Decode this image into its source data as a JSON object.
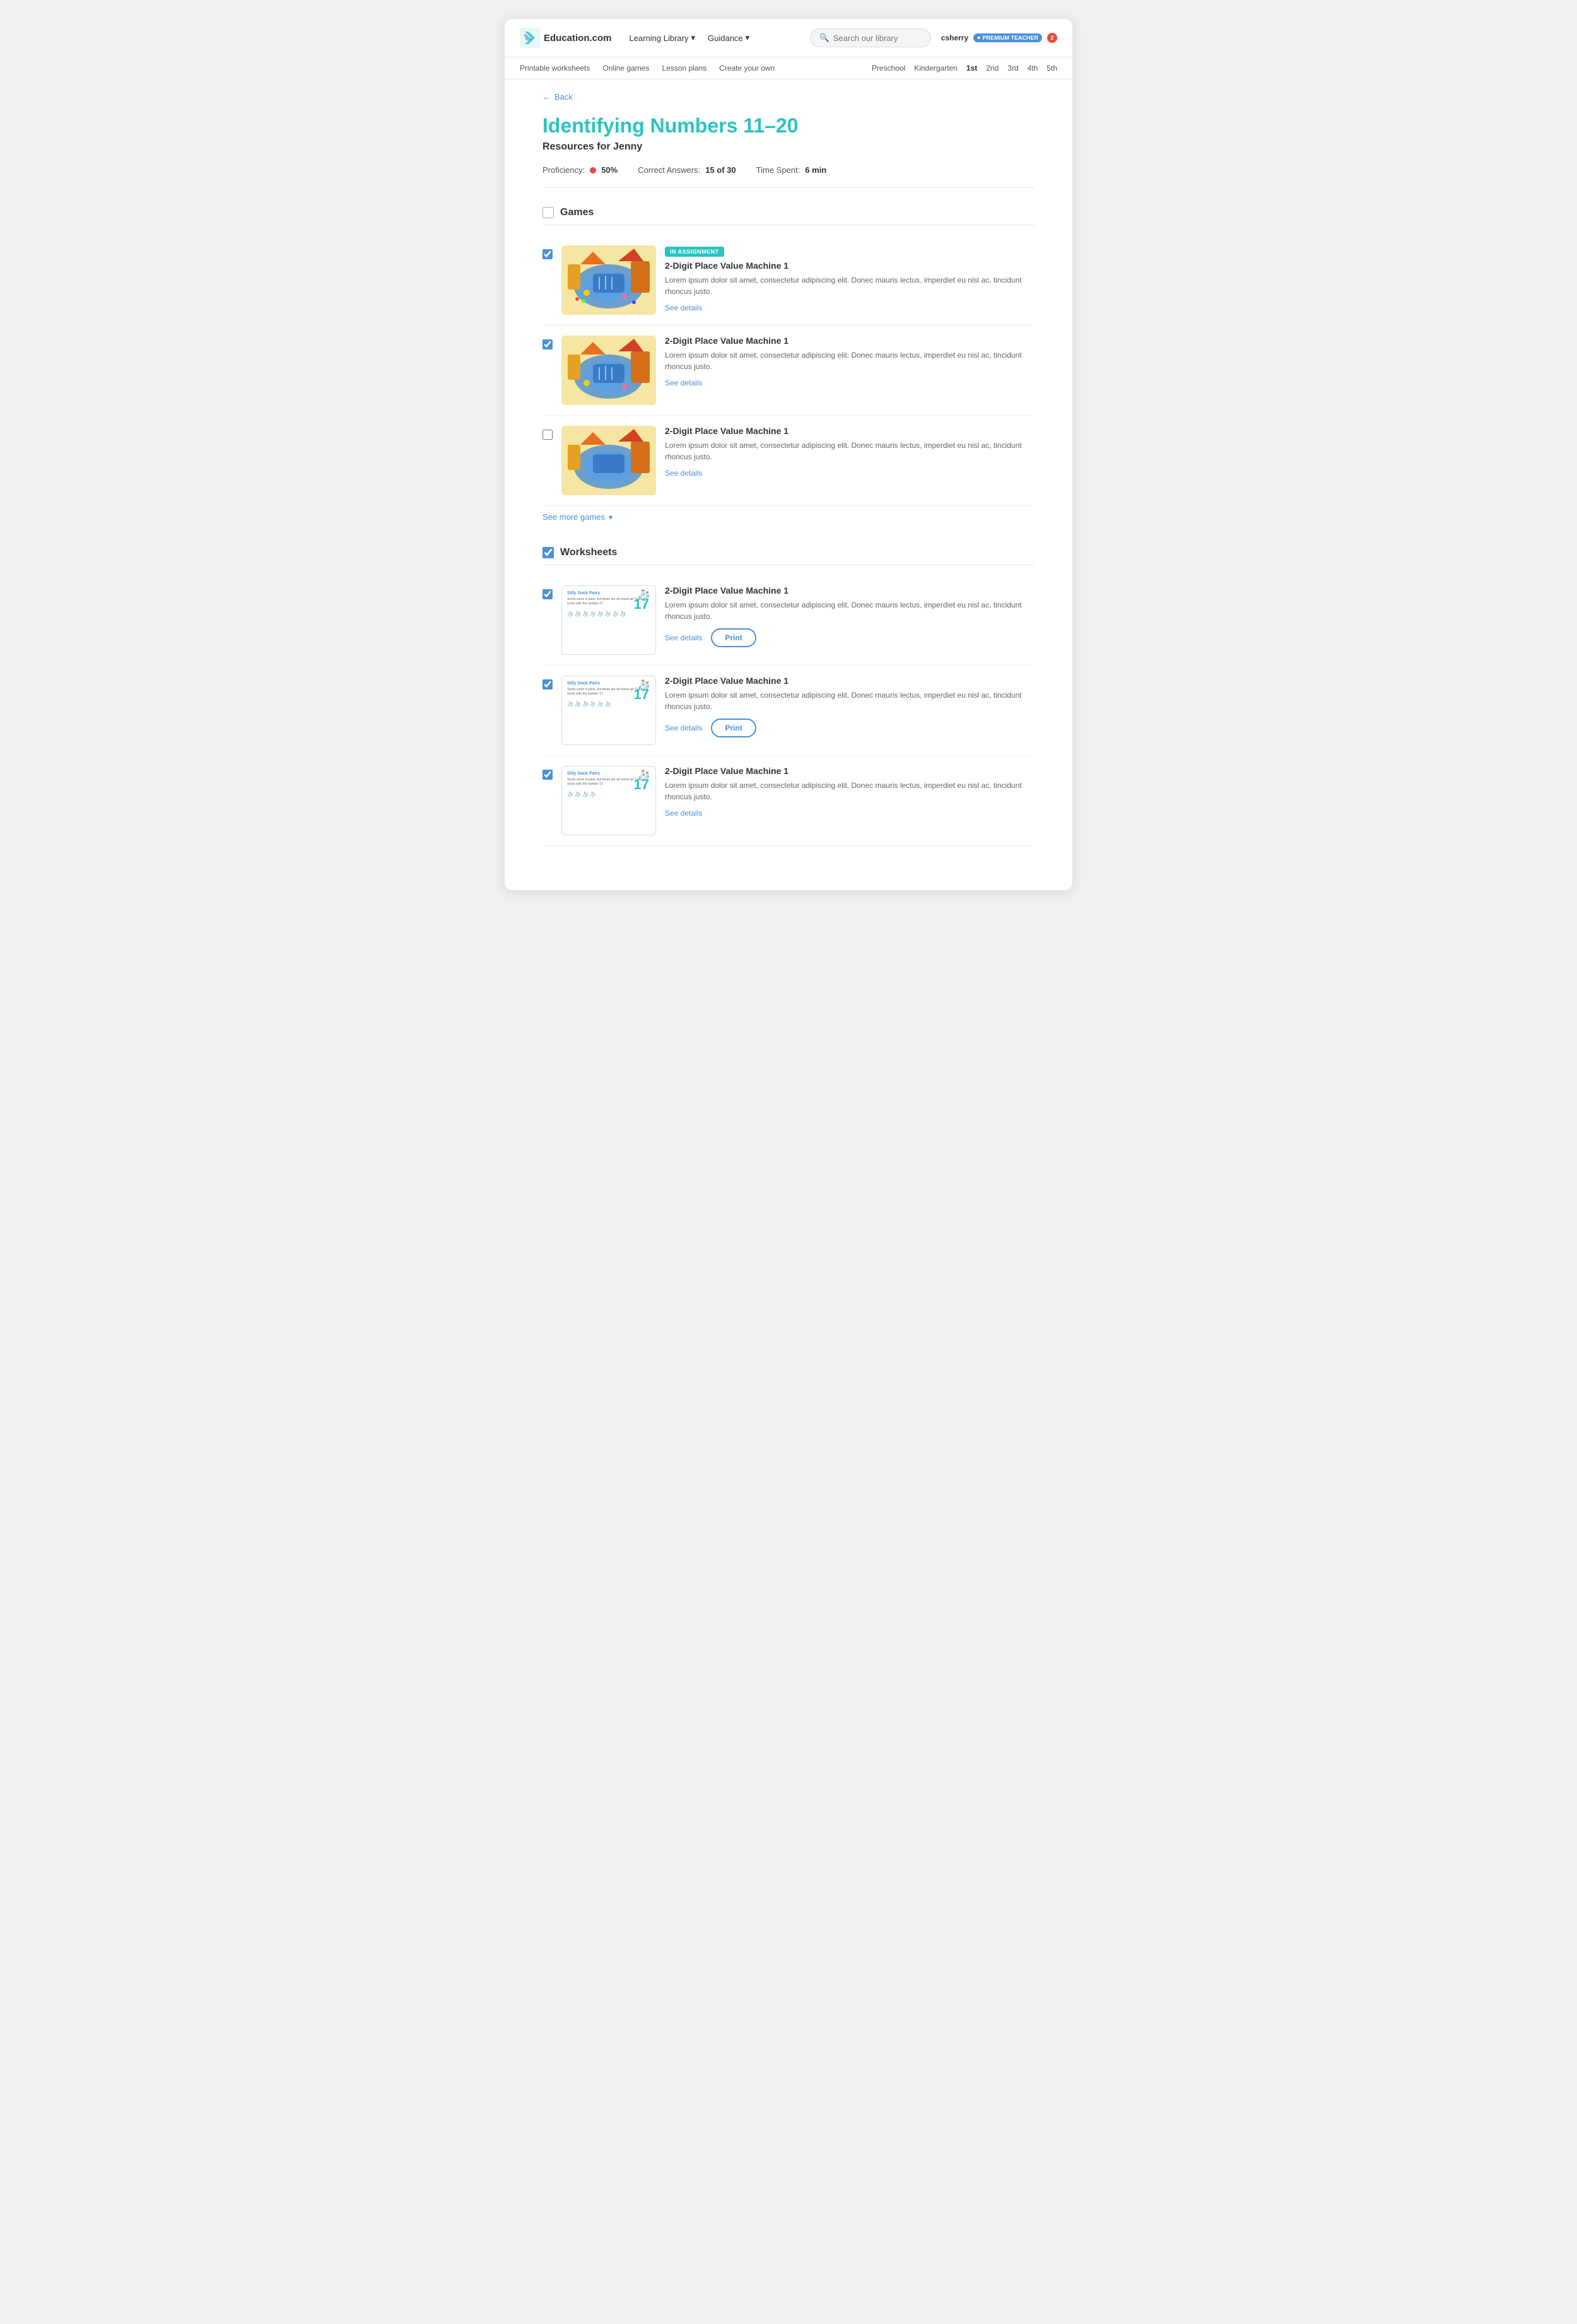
{
  "site": {
    "logo_text": "Education.com",
    "logo_icon": "🔖"
  },
  "header": {
    "nav": [
      {
        "label": "Learning Library",
        "has_arrow": true
      },
      {
        "label": "Guidance",
        "has_arrow": true
      }
    ],
    "search_placeholder": "Search our library",
    "user": {
      "username": "csherry",
      "badge_label": "PREMIUM TEACHER",
      "notification_count": "2"
    }
  },
  "sub_nav": {
    "left": [
      {
        "label": "Printable worksheets"
      },
      {
        "label": "Online games"
      },
      {
        "label": "Lesson plans"
      },
      {
        "label": "Create your own"
      }
    ],
    "right": [
      {
        "label": "Preschool"
      },
      {
        "label": "Kindergarten"
      },
      {
        "label": "1st"
      },
      {
        "label": "2nd"
      },
      {
        "label": "3rd"
      },
      {
        "label": "4th"
      },
      {
        "label": "5th"
      }
    ]
  },
  "back_label": "Back",
  "page_title": "Identifying Numbers 11–20",
  "resources_subtitle": "Resources for Jenny",
  "stats": {
    "proficiency_label": "Proficiency:",
    "proficiency_value": "50%",
    "correct_label": "Correct Answers:",
    "correct_value": "15 of 30",
    "time_label": "Time Spent:",
    "time_value": "6 min"
  },
  "sections": [
    {
      "id": "games",
      "title": "Games",
      "checked": false,
      "indeterminate": true,
      "items": [
        {
          "id": "game1",
          "checked": true,
          "in_assignment": true,
          "badge": "IN ASSIGNMENT",
          "title": "2-Digit Place Value Machine 1",
          "desc": "Lorem ipsum dolor sit amet, consectetur adipiscing elit. Donec mauris lectus, imperdiet eu nisl ac, tincidunt rhoncus justo.",
          "actions": [
            "see_details"
          ]
        },
        {
          "id": "game2",
          "checked": true,
          "in_assignment": false,
          "badge": "",
          "title": "2-Digit Place Value Machine 1",
          "desc": "Lorem ipsum dolor sit amet, consectetur adipiscing elit. Donec mauris lectus, imperdiet eu nisl ac, tincidunt rhoncus justo.",
          "actions": [
            "see_details"
          ]
        },
        {
          "id": "game3",
          "checked": false,
          "in_assignment": false,
          "badge": "",
          "title": "2-Digit Place Value Machine 1",
          "desc": "Lorem ipsum dolor sit amet, consectetur adipiscing elit. Donec mauris lectus, imperdiet eu nisl ac, tincidunt rhoncus justo.",
          "actions": [
            "see_details"
          ]
        }
      ],
      "see_more_label": "See more games"
    },
    {
      "id": "worksheets",
      "title": "Worksheets",
      "checked": true,
      "indeterminate": false,
      "items": [
        {
          "id": "ws1",
          "checked": true,
          "in_assignment": false,
          "badge": "",
          "title": "2-Digit Place Value Machine 1",
          "desc": "Lorem ipsum dolor sit amet, consectetur adipiscing elit. Donec mauris lectus, imperdiet eu nisl ac, tincidunt rhoncus justo.",
          "actions": [
            "see_details",
            "print"
          ],
          "worksheet_title": "Silly Sock Pairs",
          "worksheet_number": "17"
        },
        {
          "id": "ws2",
          "checked": true,
          "in_assignment": false,
          "badge": "",
          "title": "2-Digit Place Value Machine 1",
          "desc": "Lorem ipsum dolor sit amet, consectetur adipiscing elit. Donec mauris lectus, imperdiet eu nisl ac, tincidunt rhoncus justo.",
          "actions": [
            "see_details",
            "print"
          ],
          "worksheet_title": "Silly Sock Pairs",
          "worksheet_number": "17"
        },
        {
          "id": "ws3",
          "checked": true,
          "in_assignment": false,
          "badge": "",
          "title": "2-Digit Place Value Machine 1",
          "desc": "Lorem ipsum dolor sit amet, consectetur adipiscing elit. Donec mauris lectus, imperdiet eu nisl ac, tincidunt rhoncus justo.",
          "actions": [
            "see_details",
            "print"
          ],
          "worksheet_title": "Silly Sock Pairs",
          "worksheet_number": "17"
        }
      ]
    }
  ],
  "labels": {
    "see_details": "See details",
    "print": "Print",
    "see_more_games": "See more games"
  }
}
